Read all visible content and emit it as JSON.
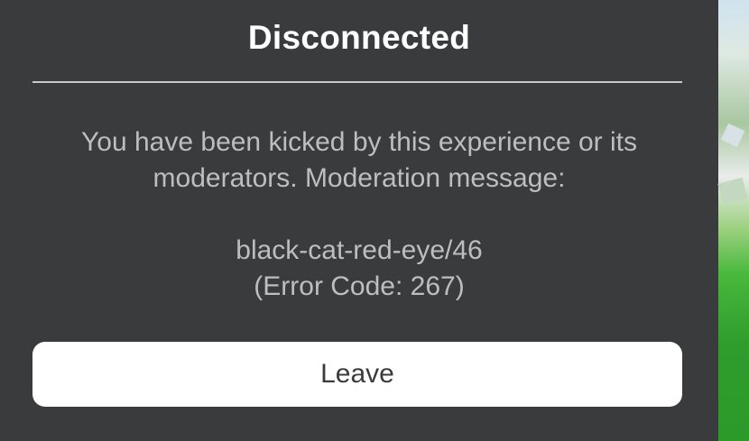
{
  "dialog": {
    "title": "Disconnected",
    "message_line1": "You have been kicked by this experience or its moderators. Moderation message:",
    "moderation_message": "black-cat-red-eye/46",
    "error_code": "(Error Code: 267)",
    "leave_label": "Leave"
  },
  "colors": {
    "dialog_bg": "#393b3d",
    "title_text": "#ffffff",
    "body_text": "#bdbebe",
    "button_bg": "#ffffff",
    "button_text": "#393b3d"
  }
}
